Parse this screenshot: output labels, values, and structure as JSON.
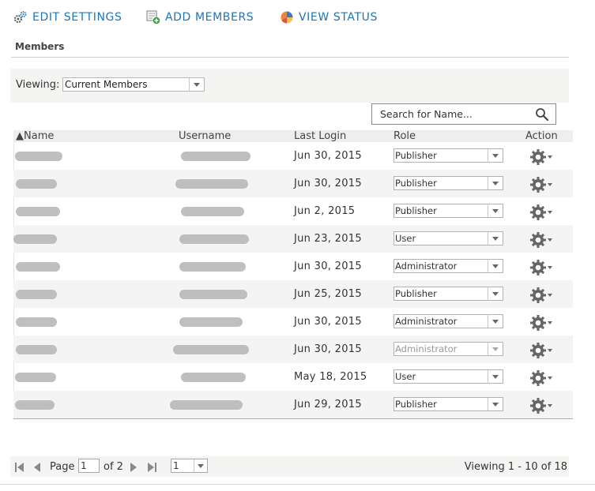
{
  "toolbar": {
    "edit_settings": "EDIT SETTINGS",
    "add_members": "ADD MEMBERS",
    "view_status": "VIEW STATUS",
    "link_color": "#1f73b7"
  },
  "section": {
    "title": "Members"
  },
  "filter": {
    "label": "Viewing:",
    "selected": "Current Members"
  },
  "search": {
    "placeholder": "Search for Name..."
  },
  "table": {
    "columns": [
      "▲Name",
      "Username",
      "Last Login",
      "Role",
      "Action"
    ],
    "rows": [
      {
        "last_login": "Jun 30, 2015",
        "role": "Publisher",
        "role_disabled": false
      },
      {
        "last_login": "Jun 30, 2015",
        "role": "Publisher",
        "role_disabled": false
      },
      {
        "last_login": "Jun 2, 2015",
        "role": "Publisher",
        "role_disabled": false
      },
      {
        "last_login": "Jun 23, 2015",
        "role": "User",
        "role_disabled": false
      },
      {
        "last_login": "Jun 30, 2015",
        "role": "Administrator",
        "role_disabled": false
      },
      {
        "last_login": "Jun 25, 2015",
        "role": "Publisher",
        "role_disabled": false
      },
      {
        "last_login": "Jun 30, 2015",
        "role": "Administrator",
        "role_disabled": false
      },
      {
        "last_login": "Jun 30, 2015",
        "role": "Administrator",
        "role_disabled": true
      },
      {
        "last_login": "May 18, 2015",
        "role": "User",
        "role_disabled": false
      },
      {
        "last_login": "Jun 29, 2015",
        "role": "Publisher",
        "role_disabled": false
      }
    ]
  },
  "pager": {
    "page_label": "Page",
    "current_page": "1",
    "of_label": "of 2",
    "page_size": "1",
    "viewing_count": "Viewing 1 - 10 of 18"
  }
}
